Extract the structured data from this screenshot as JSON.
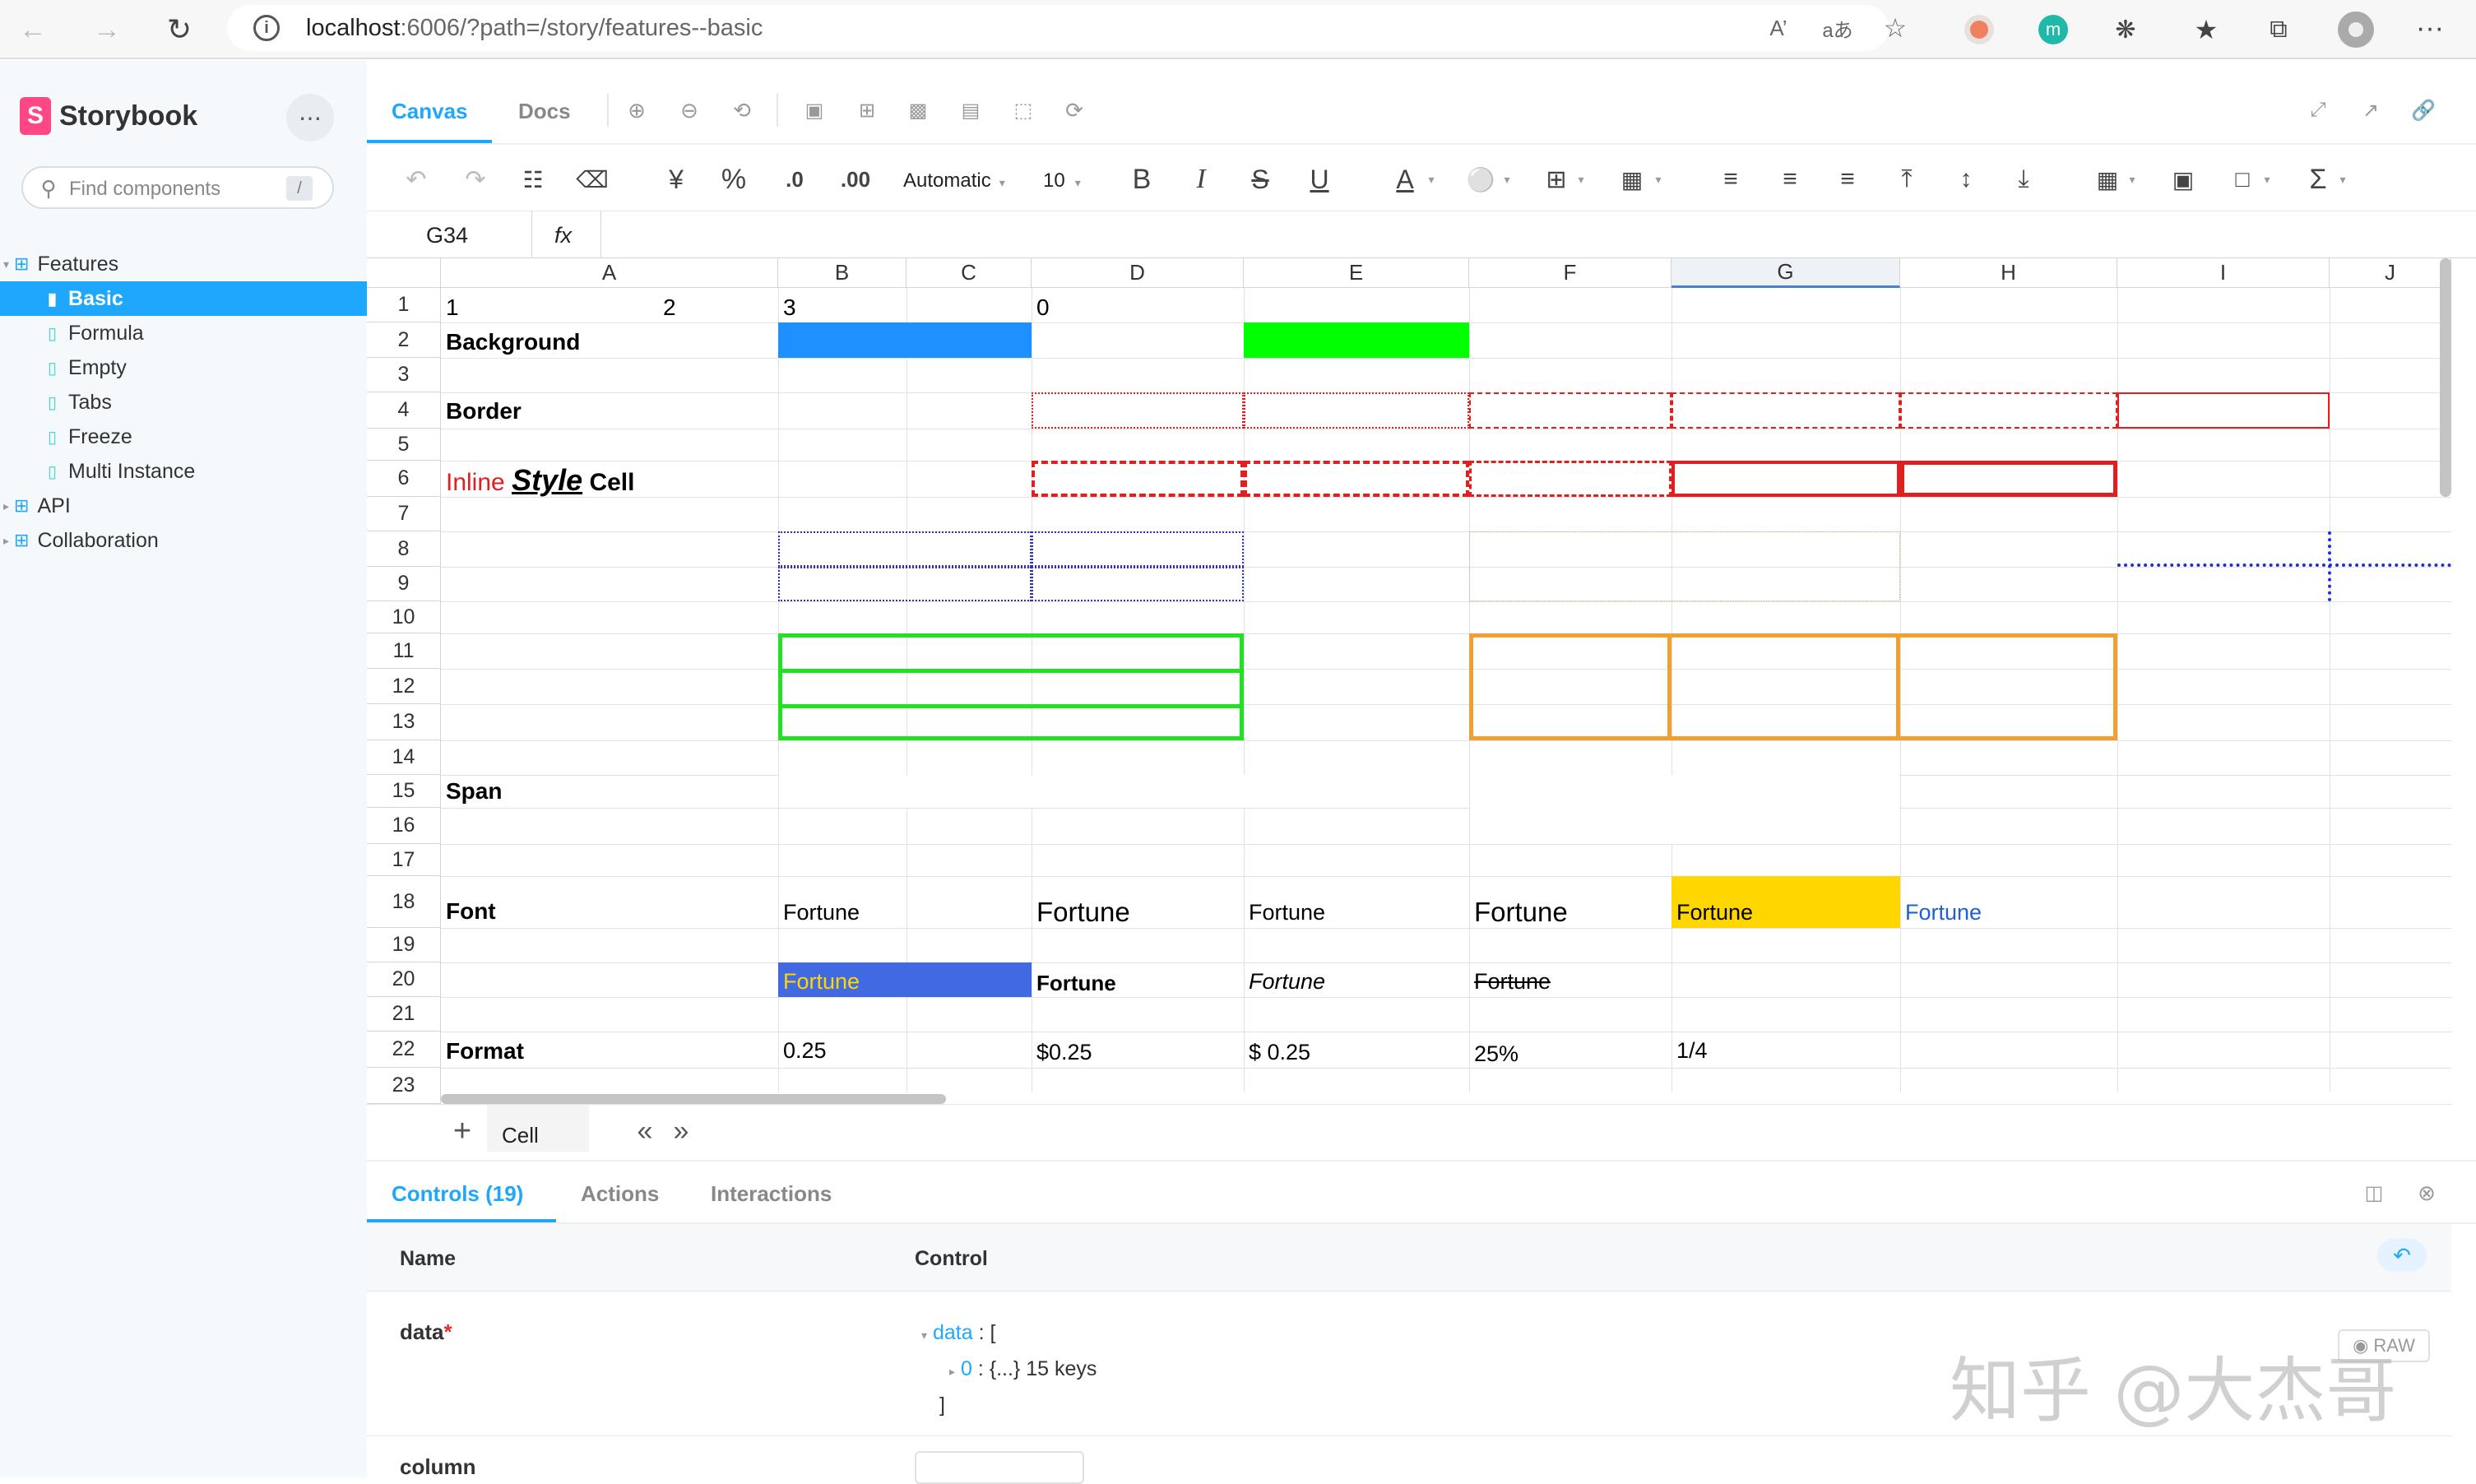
{
  "browser": {
    "url_host": "localhost",
    "url_rest": ":6006/?path=/story/features--basic",
    "menu": "···",
    "ext_m": "m"
  },
  "sidebar": {
    "title": "Storybook",
    "search_placeholder": "Find components",
    "search_shortcut": "/",
    "items": [
      {
        "label": "Features"
      },
      {
        "label": "Basic"
      },
      {
        "label": "Formula"
      },
      {
        "label": "Empty"
      },
      {
        "label": "Tabs"
      },
      {
        "label": "Freeze"
      },
      {
        "label": "Multi Instance"
      },
      {
        "label": "API"
      },
      {
        "label": "Collaboration"
      }
    ]
  },
  "tabs": {
    "canvas": "Canvas",
    "docs": "Docs"
  },
  "toolbar": {
    "currency": "¥",
    "percent": "%",
    "dec_minus": ".0",
    "dec_plus": ".00",
    "format": "Automatic",
    "font_size": "10",
    "bold": "B",
    "italic": "I",
    "strike": "S",
    "underline": "U",
    "text_color": "A",
    "sum": "Σ"
  },
  "formula": {
    "cell_ref": "G34",
    "fx": "fx"
  },
  "sheet": {
    "columns": [
      "A",
      "B",
      "C",
      "D",
      "E",
      "F",
      "G",
      "H",
      "I",
      "J"
    ],
    "rows": [
      "1",
      "2",
      "3",
      "4",
      "5",
      "6",
      "7",
      "8",
      "9",
      "10",
      "11",
      "12",
      "13",
      "14",
      "15",
      "16",
      "17",
      "18",
      "19",
      "20",
      "21",
      "22",
      "23"
    ],
    "cells": {
      "a1": "1",
      "b1": "2",
      "c1": "3",
      "d1": "0",
      "a2": "Background",
      "a4": "Border",
      "a6_inline": "Inline",
      "a6_style": "Style",
      "a6_cell": "Cell",
      "a15": "Span",
      "a18": "Font",
      "c18": "Fortune",
      "d18": "Fortune",
      "e18": "Fortune",
      "f18": "Fortune",
      "g18": "Fortune",
      "h18": "Fortune",
      "c20": "Fortune",
      "d20": "Fortune",
      "e20": "Fortune",
      "f20": "Fortune",
      "a22": "Format",
      "c22": "0.25",
      "d22": "$0.25",
      "e22": "$ 0.25",
      "f22": "25%",
      "g22": "1/4"
    },
    "colors": {
      "blue_bg": "#1e90ff",
      "green_bg": "#00ff00",
      "yellow_bg": "#ffd700",
      "royal_bg": "#4169e1",
      "orange": "#f0a030",
      "red": "#e02020"
    },
    "sheet_tab": "Cell",
    "add": "+",
    "prev": "«",
    "next": "»"
  },
  "panel": {
    "tabs": [
      "Controls (19)",
      "Actions",
      "Interactions"
    ],
    "col_name": "Name",
    "col_control": "Control",
    "row_data": "data",
    "required": "*",
    "data_key": "data",
    "data_open": " : [",
    "item_key": "0",
    "item_val": " : {...} 15 keys",
    "data_close": "]",
    "raw": "RAW",
    "next_row": "column"
  },
  "watermark": "知乎 @大杰哥"
}
